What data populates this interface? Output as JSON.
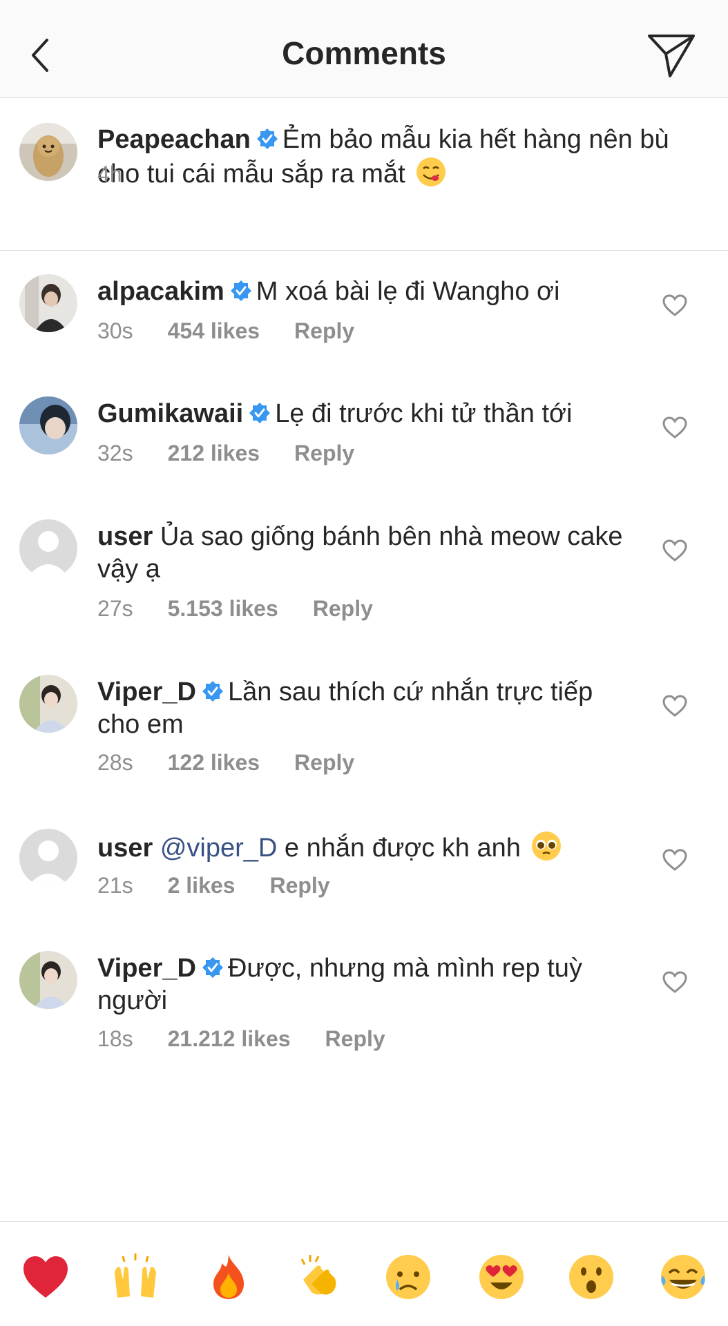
{
  "header": {
    "title": "Comments",
    "back_icon": "chevron-left-icon",
    "send_icon": "paper-plane-icon"
  },
  "caption": {
    "username": "Peapeachan",
    "verified": true,
    "text": "Ẻm bảo mẫu kia hết hàng nên bù cho tui cái mẫu sắp ra mắt",
    "emoji": "face-savoring-food-emoji",
    "time": "4h"
  },
  "comments": [
    {
      "username": "alpacakim",
      "verified": true,
      "text": "M xoá bài lẹ đi Wangho ơi",
      "time": "30s",
      "likes": "454 likes",
      "reply": "Reply"
    },
    {
      "username": "Gumikawaii",
      "verified": true,
      "text": "Lẹ đi trước khi tử thần tới",
      "time": "32s",
      "likes": "212 likes",
      "reply": "Reply"
    },
    {
      "username": "user",
      "verified": false,
      "text": "Ủa sao giống bánh bên nhà meow cake vậy ạ",
      "time": "27s",
      "likes": "5.153 likes",
      "reply": "Reply"
    },
    {
      "username": "Viper_D",
      "verified": true,
      "text": "Lần sau thích cứ nhắn trực tiếp cho em",
      "time": "28s",
      "likes": "122 likes",
      "reply": "Reply"
    },
    {
      "username": "user",
      "verified": false,
      "mention": "@viper_D",
      "text": "e nhắn được kh anh",
      "emoji": "pleading-face-emoji",
      "time": "21s",
      "likes": "2 likes",
      "reply": "Reply"
    },
    {
      "username": "Viper_D",
      "verified": true,
      "text": "Được, nhưng mà mình rep tuỳ người",
      "time": "18s",
      "likes": "21.212 likes",
      "reply": "Reply"
    }
  ],
  "quick_reactions": [
    "red-heart-emoji",
    "raising-hands-emoji",
    "fire-emoji",
    "clapping-hands-emoji",
    "crying-face-emoji",
    "heart-eyes-emoji",
    "surprised-face-emoji",
    "tears-of-joy-emoji"
  ],
  "colors": {
    "verified": "#3897f0",
    "mention": "#385185",
    "meta": "#8e8e8e"
  }
}
